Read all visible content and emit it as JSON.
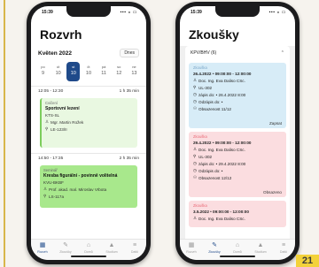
{
  "left_phone": {
    "status": {
      "time": "15:39",
      "signal": "▪▪▪ ◒ ▭"
    },
    "title": "Rozvrh",
    "month": "Květen 2022",
    "today_button": "Dnes",
    "days": [
      {
        "name": "po",
        "date": "9"
      },
      {
        "name": "út",
        "date": "10"
      },
      {
        "name": "st",
        "date": "10"
      },
      {
        "name": "čt",
        "date": "10"
      },
      {
        "name": "pá",
        "date": "11"
      },
      {
        "name": "so",
        "date": "12"
      },
      {
        "name": "ne",
        "date": "13"
      }
    ],
    "events": [
      {
        "time": "12:05 - 12:30",
        "duration": "1 h 35 min",
        "type": "Cvičení",
        "name": "Sportovní lezení",
        "code": "KTS-SL",
        "teacher": "Mgr. Martin Rožek",
        "room": "LE-123/II"
      },
      {
        "time": "14:50 - 17:35",
        "duration": "2 h 35 min",
        "type": "Seminář",
        "name": "Kresba figurální - povinně volitelná",
        "code": "KVU-BKBF",
        "teacher": "Prof. akad. mal. Miroslav Vrbota",
        "room": "LS-117a"
      }
    ],
    "tabs": [
      "Rozvrh",
      "Zkoušky",
      "Domů",
      "Studium",
      "Další"
    ]
  },
  "right_phone": {
    "status": {
      "time": "15:39",
      "signal": "▪▪▪ ◒ ▭"
    },
    "title": "Zkoušky",
    "group": "KPV/BHV (6)",
    "exams": [
      {
        "type": "Zkouška",
        "datetime": "26.4.2022 • 09:00:00 - 12:00:00",
        "teacher": "Doc. Ing. Eva Daliso CSc.",
        "room": "UL-302",
        "signup": "zápis do: • 26.4.2022 8:00",
        "unsignup": "Odzápis do: •",
        "capacity": "Obsazenost 11/12",
        "action": "Zapsat",
        "color": "blue"
      },
      {
        "type": "Zkouška",
        "datetime": "29.4.2022 • 09:00:00 - 12:00:00",
        "teacher": "Doc. Ing. Eva Daliso CSc.",
        "room": "UL-302",
        "signup": "zápis do: • 29.4.2022 8:00",
        "unsignup": "Odzápis do: •",
        "capacity": "Obsazenost 12/12",
        "action": "Obsazeno",
        "color": "red"
      },
      {
        "type": "Zkouška",
        "datetime": "3.5.2022 • 09:00:00 - 12:00:00",
        "teacher": "Doc. Ing. Eva Daliso CSc.",
        "room": "",
        "signup": "",
        "unsignup": "",
        "capacity": "",
        "action": "",
        "color": "red"
      }
    ],
    "tabs": [
      "Rozvrh",
      "Zkoušky",
      "Domů",
      "Studium",
      "Další"
    ]
  },
  "badge": "21",
  "icons": {
    "calendar": "calendar-icon",
    "exam": "pencil-icon",
    "home": "home-icon",
    "study": "graduation-cap-icon",
    "more": "menu-icon",
    "person": "person-icon",
    "location": "location-pin-icon",
    "clock": "clock-icon",
    "chevron": "chevron-up-icon"
  },
  "colors": {
    "accent": "#1f4a8a",
    "event_light_green": "#e9f8e1",
    "event_green": "#a8e88c",
    "exam_blue": "#d7ecf7",
    "exam_red": "#fbdde0"
  }
}
